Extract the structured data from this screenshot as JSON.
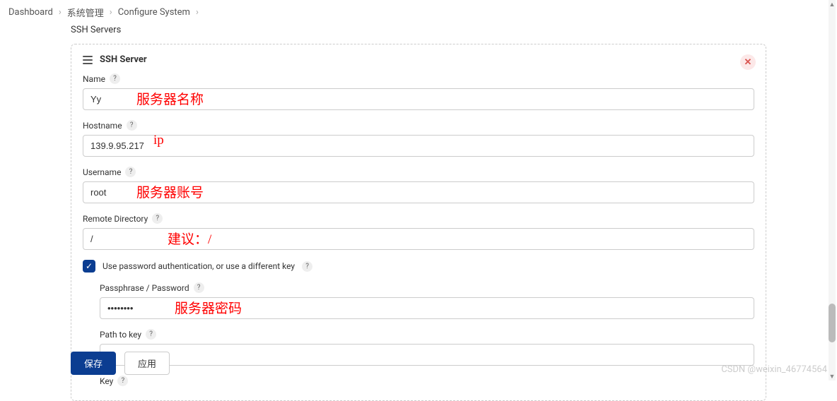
{
  "breadcrumb": {
    "items": [
      "Dashboard",
      "系统管理",
      "Configure System"
    ]
  },
  "section": {
    "title": "SSH Servers"
  },
  "card": {
    "title": "SSH Server"
  },
  "fields": {
    "name": {
      "label": "Name",
      "value": "Yy",
      "annotation": "服务器名称"
    },
    "hostname": {
      "label": "Hostname",
      "value": "139.9.95.217",
      "annotation": "ip"
    },
    "username": {
      "label": "Username",
      "value": "root",
      "annotation": "服务器账号"
    },
    "remote_directory": {
      "label": "Remote Directory",
      "value": "/",
      "annotation": "建议：/"
    },
    "use_password": {
      "label": "Use password authentication, or use a different key",
      "checked": true
    },
    "passphrase": {
      "label": "Passphrase / Password",
      "value": "••••••••",
      "annotation": "服务器密码"
    },
    "path_to_key": {
      "label": "Path to key",
      "value": ""
    },
    "key": {
      "label": "Key"
    }
  },
  "buttons": {
    "save": "保存",
    "apply": "应用"
  },
  "watermark": "CSDN @weixin_46774564"
}
